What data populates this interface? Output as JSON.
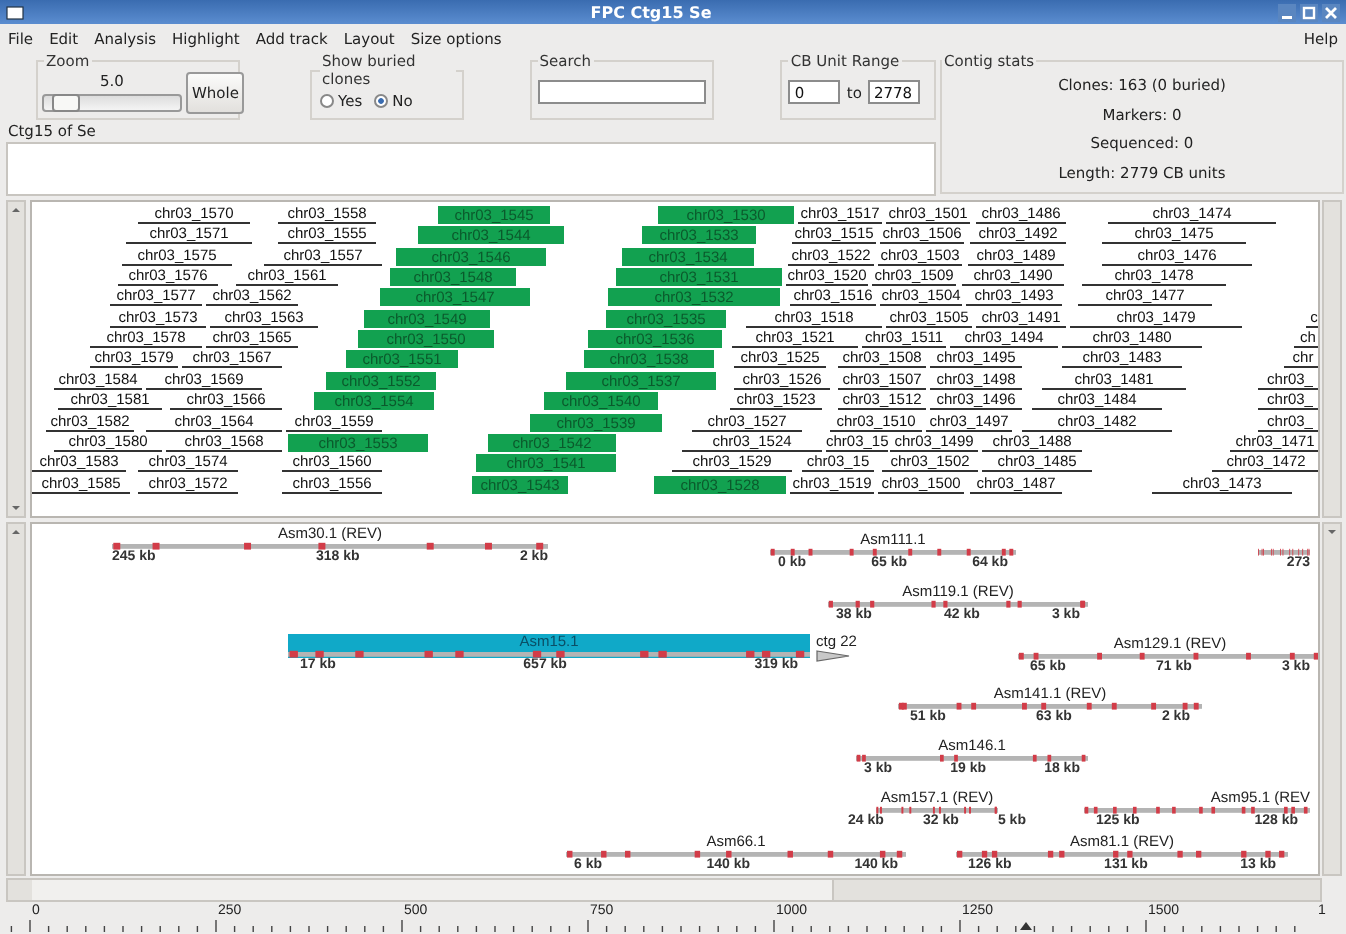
{
  "window": {
    "title": "FPC Ctg15 Se"
  },
  "menu": [
    "File",
    "Edit",
    "Analysis",
    "Highlight",
    "Add track",
    "Layout",
    "Size options"
  ],
  "help_menu": "Help",
  "zoom": {
    "label": "Zoom",
    "value": "5.0",
    "level": 0.12,
    "button": "Whole"
  },
  "buried_clones": {
    "label": "Show buried clones",
    "options": [
      {
        "label": "Yes",
        "selected": false
      },
      {
        "label": "No",
        "selected": true
      }
    ]
  },
  "search": {
    "label": "Search"
  },
  "cb_range": {
    "label": "CB Unit Range",
    "from": "0",
    "to_label": "to",
    "to": "2778"
  },
  "contig_label": "Ctg15 of Se",
  "contig_stats": {
    "label": "Contig stats",
    "lines": [
      "Clones: 163 (0 buried)",
      "Markers: 0",
      "Sequenced: 0",
      "Length: 2779 CB units"
    ]
  },
  "clone_rows": [
    {
      "clones": [
        {
          "name": "chr03_1570",
          "highlighted": false
        },
        {
          "name": "chr03_1558",
          "highlighted": false
        },
        {
          "name": "chr03_1545",
          "highlighted": true
        },
        {
          "name": "chr03_1530",
          "highlighted": true
        },
        {
          "name": "chr03_1517",
          "highlighted": false
        },
        {
          "name": "chr03_1501",
          "highlighted": false
        },
        {
          "name": "chr03_1486",
          "highlighted": false
        },
        {
          "name": "chr03_1474",
          "highlighted": false
        }
      ]
    },
    {
      "clones": [
        {
          "name": "chr03_1571",
          "highlighted": false
        },
        {
          "name": "chr03_1555",
          "highlighted": false
        },
        {
          "name": "chr03_1544",
          "highlighted": true
        },
        {
          "name": "chr03_1533",
          "highlighted": true
        },
        {
          "name": "chr03_1515",
          "highlighted": false
        },
        {
          "name": "chr03_1506",
          "highlighted": false
        },
        {
          "name": "chr03_1492",
          "highlighted": false
        },
        {
          "name": "chr03_1475",
          "highlighted": false
        }
      ]
    },
    {
      "clones": [
        {
          "name": "chr03_1575",
          "highlighted": false
        },
        {
          "name": "chr03_1557",
          "highlighted": false
        },
        {
          "name": "chr03_1546",
          "highlighted": true
        },
        {
          "name": "chr03_1534",
          "highlighted": true
        },
        {
          "name": "chr03_1522",
          "highlighted": false
        },
        {
          "name": "chr03_1503",
          "highlighted": false
        },
        {
          "name": "chr03_1489",
          "highlighted": false
        },
        {
          "name": "chr03_1476",
          "highlighted": false
        }
      ]
    },
    {
      "clones": [
        {
          "name": "chr03_1576",
          "highlighted": false
        },
        {
          "name": "chr03_1561",
          "highlighted": false
        },
        {
          "name": "chr03_1548",
          "highlighted": true
        },
        {
          "name": "chr03_1531",
          "highlighted": true
        },
        {
          "name": "chr03_1520",
          "highlighted": false
        },
        {
          "name": "chr03_1509",
          "highlighted": false
        },
        {
          "name": "chr03_1490",
          "highlighted": false
        },
        {
          "name": "chr03_1478",
          "highlighted": false
        }
      ]
    },
    {
      "clones": [
        {
          "name": "chr03_1577",
          "highlighted": false
        },
        {
          "name": "chr03_1562",
          "highlighted": false
        },
        {
          "name": "chr03_1547",
          "highlighted": true
        },
        {
          "name": "chr03_1532",
          "highlighted": true
        },
        {
          "name": "chr03_1516",
          "highlighted": false
        },
        {
          "name": "chr03_1504",
          "highlighted": false
        },
        {
          "name": "chr03_1493",
          "highlighted": false
        },
        {
          "name": "chr03_1477",
          "highlighted": false
        }
      ]
    },
    {
      "clones": [
        {
          "name": "chr03_1573",
          "highlighted": false
        },
        {
          "name": "chr03_1563",
          "highlighted": false
        },
        {
          "name": "chr03_1549",
          "highlighted": true
        },
        {
          "name": "chr03_1535",
          "highlighted": true
        },
        {
          "name": "chr03_1518",
          "highlighted": false
        },
        {
          "name": "chr03_1505",
          "highlighted": false
        },
        {
          "name": "chr03_1491",
          "highlighted": false
        },
        {
          "name": "chr03_1479",
          "highlighted": false
        },
        {
          "name": "c",
          "highlighted": false
        }
      ]
    },
    {
      "clones": [
        {
          "name": "chr03_1578",
          "highlighted": false
        },
        {
          "name": "chr03_1565",
          "highlighted": false
        },
        {
          "name": "chr03_1550",
          "highlighted": true
        },
        {
          "name": "chr03_1536",
          "highlighted": true
        },
        {
          "name": "chr03_1521",
          "highlighted": false
        },
        {
          "name": "chr03_1511",
          "highlighted": false
        },
        {
          "name": "chr03_1494",
          "highlighted": false
        },
        {
          "name": "chr03_1480",
          "highlighted": false
        },
        {
          "name": "ch",
          "highlighted": false
        }
      ]
    },
    {
      "clones": [
        {
          "name": "chr03_1579",
          "highlighted": false
        },
        {
          "name": "chr03_1567",
          "highlighted": false
        },
        {
          "name": "chr03_1551",
          "highlighted": true
        },
        {
          "name": "chr03_1538",
          "highlighted": true
        },
        {
          "name": "chr03_1525",
          "highlighted": false
        },
        {
          "name": "chr03_1508",
          "highlighted": false
        },
        {
          "name": "chr03_1495",
          "highlighted": false
        },
        {
          "name": "chr03_1483",
          "highlighted": false
        },
        {
          "name": "chr",
          "highlighted": false
        }
      ]
    },
    {
      "clones": [
        {
          "name": "chr03_1584",
          "highlighted": false
        },
        {
          "name": "chr03_1569",
          "highlighted": false
        },
        {
          "name": "chr03_1552",
          "highlighted": true
        },
        {
          "name": "chr03_1537",
          "highlighted": true
        },
        {
          "name": "chr03_1526",
          "highlighted": false
        },
        {
          "name": "chr03_1507",
          "highlighted": false
        },
        {
          "name": "chr03_1498",
          "highlighted": false
        },
        {
          "name": "chr03_1481",
          "highlighted": false
        },
        {
          "name": "chr03_",
          "highlighted": false
        }
      ]
    },
    {
      "clones": [
        {
          "name": "chr03_1581",
          "highlighted": false
        },
        {
          "name": "chr03_1566",
          "highlighted": false
        },
        {
          "name": "chr03_1554",
          "highlighted": true
        },
        {
          "name": "chr03_1540",
          "highlighted": true
        },
        {
          "name": "chr03_1523",
          "highlighted": false
        },
        {
          "name": "chr03_1512",
          "highlighted": false
        },
        {
          "name": "chr03_1496",
          "highlighted": false
        },
        {
          "name": "chr03_1484",
          "highlighted": false
        },
        {
          "name": "chr03_",
          "highlighted": false
        }
      ]
    },
    {
      "clones": [
        {
          "name": "chr03_1582",
          "highlighted": false
        },
        {
          "name": "chr03_1564",
          "highlighted": false
        },
        {
          "name": "chr03_1559",
          "highlighted": false
        },
        {
          "name": "chr03_1539",
          "highlighted": true
        },
        {
          "name": "chr03_1527",
          "highlighted": false
        },
        {
          "name": "chr03_1510",
          "highlighted": false
        },
        {
          "name": "chr03_1497",
          "highlighted": false
        },
        {
          "name": "chr03_1482",
          "highlighted": false
        },
        {
          "name": "chr03_",
          "highlighted": false
        }
      ]
    },
    {
      "clones": [
        {
          "name": "chr03_1580",
          "highlighted": false
        },
        {
          "name": "chr03_1568",
          "highlighted": false
        },
        {
          "name": "chr03_1553",
          "highlighted": true
        },
        {
          "name": "chr03_1542",
          "highlighted": true
        },
        {
          "name": "chr03_1524",
          "highlighted": false
        },
        {
          "name": "chr03_15",
          "highlighted": false
        },
        {
          "name": "chr03_1499",
          "highlighted": false
        },
        {
          "name": "chr03_1488",
          "highlighted": false
        },
        {
          "name": "chr03_1471",
          "highlighted": false
        }
      ]
    },
    {
      "clones": [
        {
          "name": "chr03_1583",
          "highlighted": false
        },
        {
          "name": "chr03_1574",
          "highlighted": false
        },
        {
          "name": "chr03_1560",
          "highlighted": false
        },
        {
          "name": "chr03_1541",
          "highlighted": true
        },
        {
          "name": "chr03_1529",
          "highlighted": false
        },
        {
          "name": "chr03_15",
          "highlighted": false
        },
        {
          "name": "chr03_1502",
          "highlighted": false
        },
        {
          "name": "chr03_1485",
          "highlighted": false
        },
        {
          "name": "chr03_1472",
          "highlighted": false
        }
      ]
    },
    {
      "clones": [
        {
          "name": "chr03_1585",
          "highlighted": false
        },
        {
          "name": "chr03_1572",
          "highlighted": false
        },
        {
          "name": "chr03_1556",
          "highlighted": false
        },
        {
          "name": "chr03_1543",
          "highlighted": true
        },
        {
          "name": "chr03_1528",
          "highlighted": true
        },
        {
          "name": "chr03_1519",
          "highlighted": false
        },
        {
          "name": "chr03_1500",
          "highlighted": false
        },
        {
          "name": "chr03_1487",
          "highlighted": false
        },
        {
          "name": "chr03_1473",
          "highlighted": false
        }
      ]
    }
  ],
  "assemblies": [
    {
      "name": "Asm30.1 (REV)",
      "highlighted": false,
      "labels": [
        "245 kb",
        "318 kb",
        "2 kb"
      ]
    },
    {
      "name": "Asm111.1",
      "highlighted": false,
      "labels": [
        "0 kb",
        "65 kb",
        "64 kb"
      ]
    },
    {
      "highlighted": false,
      "labels": [
        "273"
      ]
    },
    {
      "name": "Asm119.1 (REV)",
      "highlighted": false,
      "labels": [
        "38 kb",
        "42 kb",
        "3 kb"
      ]
    },
    {
      "name": "Asm15.1",
      "highlighted": true,
      "labels": [
        "17 kb",
        "657 kb",
        "319 kb"
      ],
      "end_label": "ctg 22"
    },
    {
      "name": "Asm129.1 (REV)",
      "highlighted": false,
      "labels": [
        "65 kb",
        "71 kb",
        "3 kb"
      ]
    },
    {
      "name": "Asm141.1 (REV)",
      "highlighted": false,
      "labels": [
        "51 kb",
        "63 kb",
        "2 kb"
      ]
    },
    {
      "name": "Asm146.1",
      "highlighted": false,
      "labels": [
        "3 kb",
        "19 kb",
        "18 kb"
      ]
    },
    {
      "name": "Asm157.1 (REV)",
      "highlighted": false,
      "labels": [
        "24 kb",
        "32 kb",
        "5 kb"
      ]
    },
    {
      "name": "Asm95.1 (REV",
      "highlighted": false,
      "labels": [
        "125 kb",
        "128 kb"
      ]
    },
    {
      "name": "Asm66.1",
      "highlighted": false,
      "labels": [
        "6 kb",
        "140 kb",
        "140 kb"
      ]
    },
    {
      "name": "Asm81.1 (REV)",
      "highlighted": false,
      "labels": [
        "126 kb",
        "131 kb",
        "13 kb"
      ]
    }
  ],
  "ruler": {
    "ticks": [
      "0",
      "250",
      "500",
      "750",
      "1000",
      "1250",
      "1500",
      "1"
    ]
  }
}
